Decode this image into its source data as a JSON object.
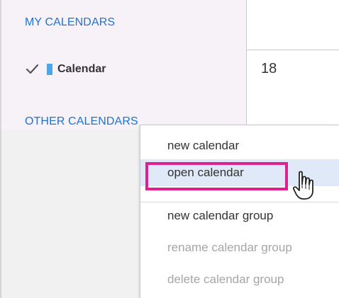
{
  "sidebar": {
    "my_calendars_title": "MY CALENDARS",
    "calendar_item_label": "Calendar",
    "calendar_item_color": "#4aa7e8",
    "other_calendars_title": "OTHER CALENDARS"
  },
  "calendar": {
    "day_number": "18"
  },
  "context_menu": {
    "items": [
      {
        "label": "new calendar",
        "enabled": true
      },
      {
        "label": "open calendar",
        "enabled": true,
        "highlighted": true
      },
      {
        "label": "new calendar group",
        "enabled": true
      },
      {
        "label": "rename calendar group",
        "enabled": false
      },
      {
        "label": "delete calendar group",
        "enabled": false
      }
    ]
  },
  "colors": {
    "accent_blue": "#1e73d2",
    "highlight_pink": "#e0208f",
    "hover_bg": "#dfe9f8"
  },
  "icons": {
    "check": "check-icon",
    "cursor": "hand-cursor-icon"
  }
}
